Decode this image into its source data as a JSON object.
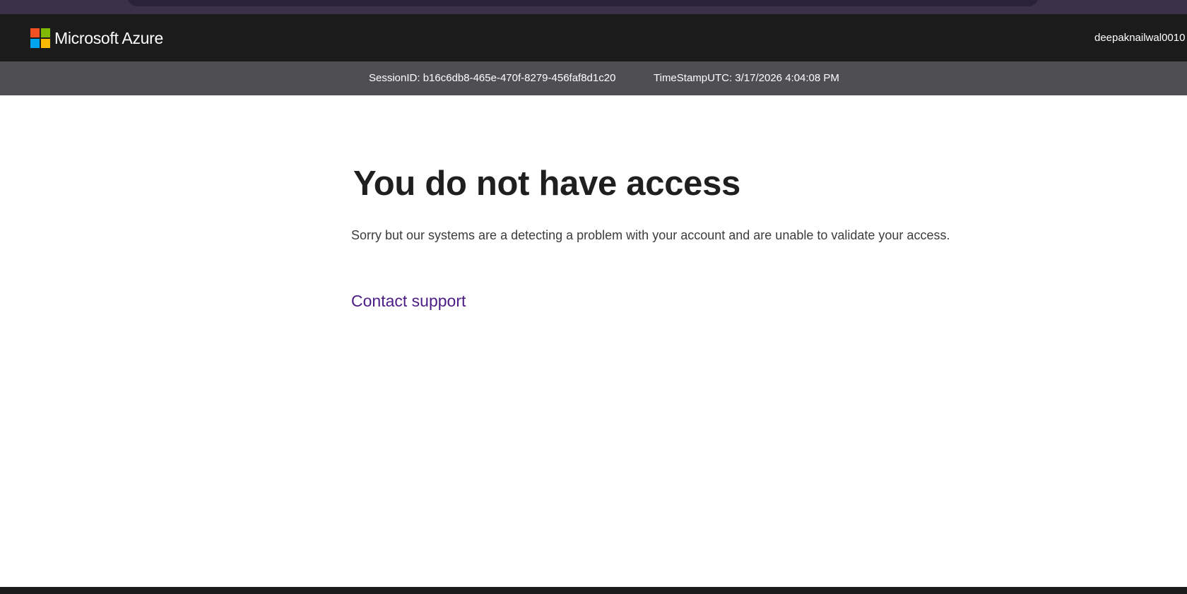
{
  "header": {
    "brand_name": "Microsoft Azure",
    "logo_colors": [
      "#f25022",
      "#7fba00",
      "#00a4ef",
      "#ffb900"
    ],
    "user_name": "deepaknailwal0010"
  },
  "session": {
    "session_id_label": "SessionID: b16c6db8-465e-470f-8279-456faf8d1c20",
    "timestamp_label": "TimeStampUTC: 3/17/2026 4:04:08 PM"
  },
  "main": {
    "heading": "You do not have access",
    "message": "Sorry but our systems are a detecting a problem with your account and are unable to validate your access.",
    "contact_link": "Contact support"
  },
  "colors": {
    "topbar": "#1b1b1c",
    "session_bar": "#4f4f53",
    "link": "#4b1c86"
  }
}
